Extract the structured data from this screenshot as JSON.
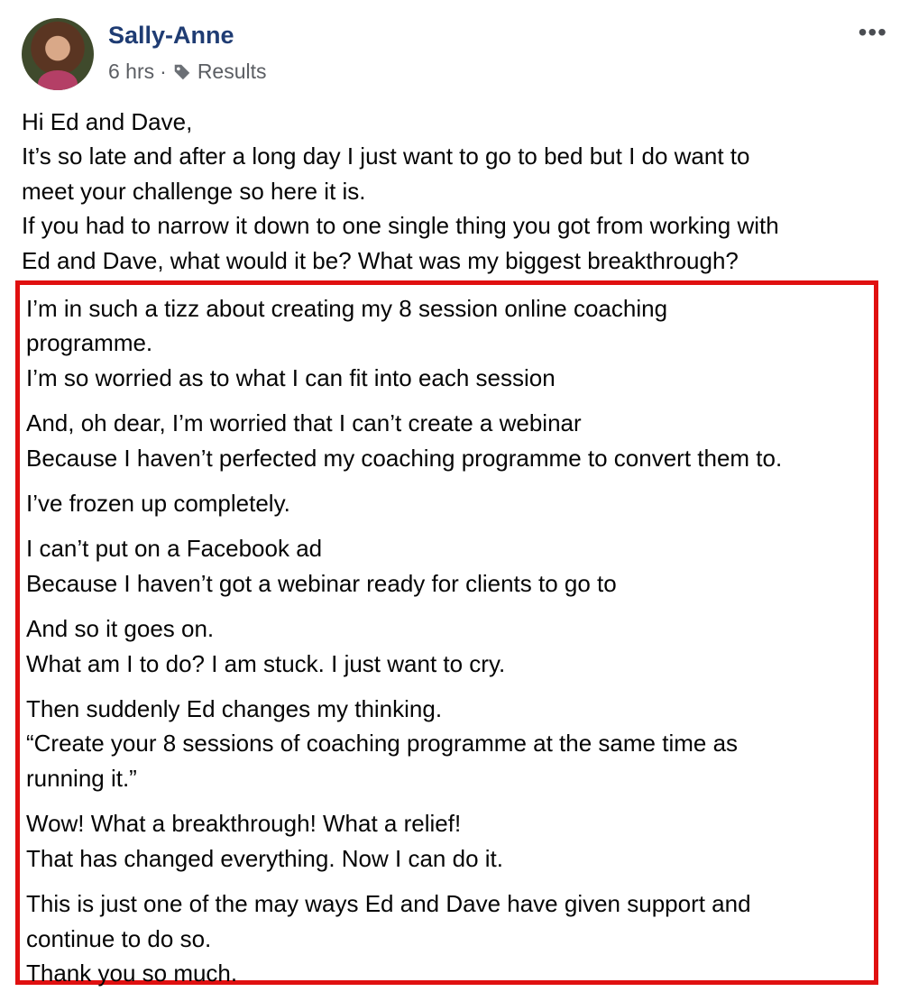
{
  "post": {
    "author": "Sally-Anne",
    "time": "6 hrs",
    "separator": "·",
    "topic": "Results",
    "more_icon": "•••",
    "intro": [
      "Hi Ed and Dave,",
      "It’s so late and after a long day I just want to go to bed but I do want to",
      "meet your challenge so here it is.",
      "If you had to narrow it down to one single thing you got from working with",
      "Ed and Dave, what would it be? What was my biggest breakthrough?"
    ],
    "highlight_color": "#e01010",
    "highlight_paragraphs": [
      [
        "I’m in such a tizz about creating my 8 session online coaching",
        "programme.",
        "I’m so worried as to what I can fit into each session"
      ],
      [
        "And, oh dear, I’m worried that I can’t create a webinar",
        "Because I haven’t perfected my coaching programme to convert them to."
      ],
      [
        "I’ve frozen up completely."
      ],
      [
        "I can’t put on a Facebook ad",
        "Because I haven’t got a webinar ready for clients to go to"
      ],
      [
        "And so it goes on.",
        "What am I to do? I am stuck. I just want to cry."
      ],
      [
        "Then suddenly Ed changes my thinking.",
        "“Create your 8 sessions of coaching programme at the same time as",
        "running it.”"
      ],
      [
        "Wow! What a breakthrough! What a relief!",
        "That has changed everything. Now I can do it."
      ],
      [
        "This is just one of the may ways Ed and Dave have given support and",
        "continue to do so.",
        "Thank you so much."
      ]
    ]
  }
}
